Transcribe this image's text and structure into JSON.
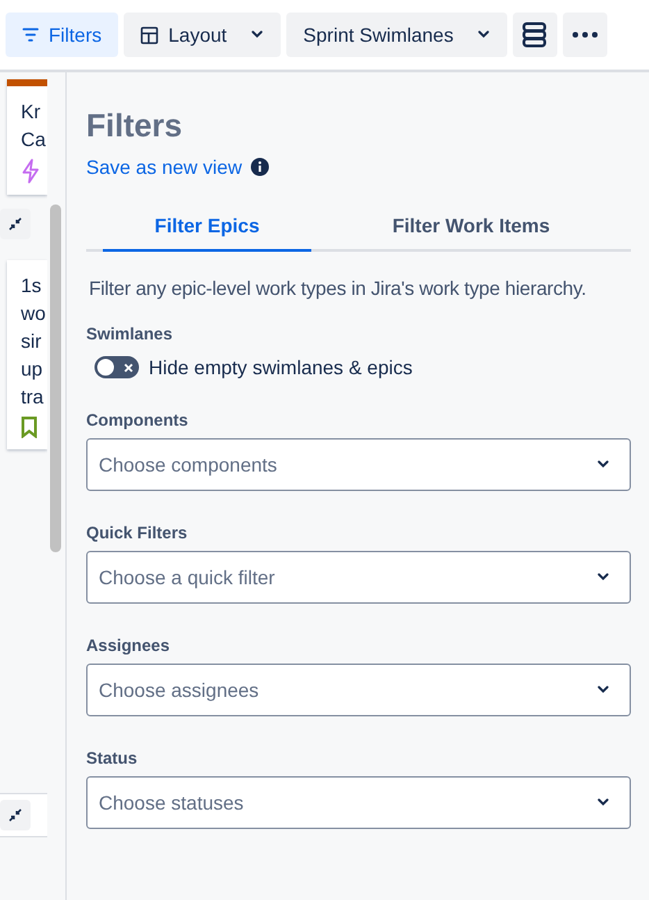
{
  "toolbar": {
    "buttons": [
      {
        "label": "Filters",
        "kind": "filter",
        "selected": true
      },
      {
        "label": "Layout",
        "kind": "layout",
        "selected": false
      },
      {
        "label": "Sprint Swimlanes",
        "kind": "dropdown",
        "selected": false
      }
    ]
  },
  "board": {
    "cards": [
      {
        "lines": [
          "Kr",
          "Ca"
        ],
        "kind": "lightning",
        "color": "#c25100"
      },
      {
        "lines": [
          "1s",
          "wo",
          "sir",
          "up",
          "tra"
        ],
        "kind": "bookmark"
      }
    ]
  },
  "panel": {
    "title": "Filters",
    "save_link": "Save as new view",
    "tabs": [
      {
        "label": "Filter Epics",
        "selected": true
      },
      {
        "label": "Filter Work Items",
        "selected": false
      }
    ],
    "description": "Filter any epic-level work types in Jira's work type hierarchy.",
    "swimlanes": {
      "label": "Swimlanes",
      "toggle_label": "Hide empty swimlanes & epics",
      "on": false
    },
    "fields": [
      {
        "label": "Components",
        "placeholder": "Choose components"
      },
      {
        "label": "Quick Filters",
        "placeholder": "Choose a quick filter"
      },
      {
        "label": "Assignees",
        "placeholder": "Choose assignees"
      },
      {
        "label": "Status",
        "placeholder": "Choose statuses"
      }
    ]
  }
}
